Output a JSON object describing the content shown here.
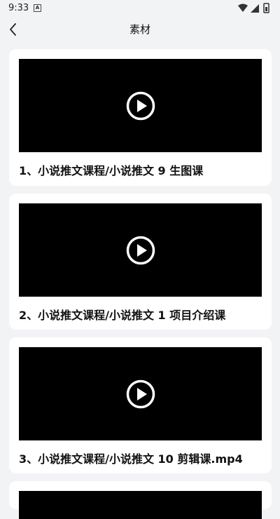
{
  "status": {
    "time": "9:33",
    "notification_badge": "A"
  },
  "header": {
    "title": "素材",
    "back_icon": "back-arrow-icon"
  },
  "items": [
    {
      "title": "1、小说推文课程/小说推文 9 生图课",
      "thumbnail": "black video thumbnail",
      "icon": "play-icon"
    },
    {
      "title": "2、小说推文课程/小说推文 1 项目介绍课",
      "thumbnail": "black video thumbnail",
      "icon": "play-icon"
    },
    {
      "title": "3、小说推文课程/小说推文 10 剪辑课.mp4",
      "thumbnail": "black video thumbnail",
      "icon": "play-icon"
    }
  ],
  "colors": {
    "background": "#f2f3f5",
    "card": "#ffffff",
    "video": "#000000",
    "text": "#111111"
  }
}
